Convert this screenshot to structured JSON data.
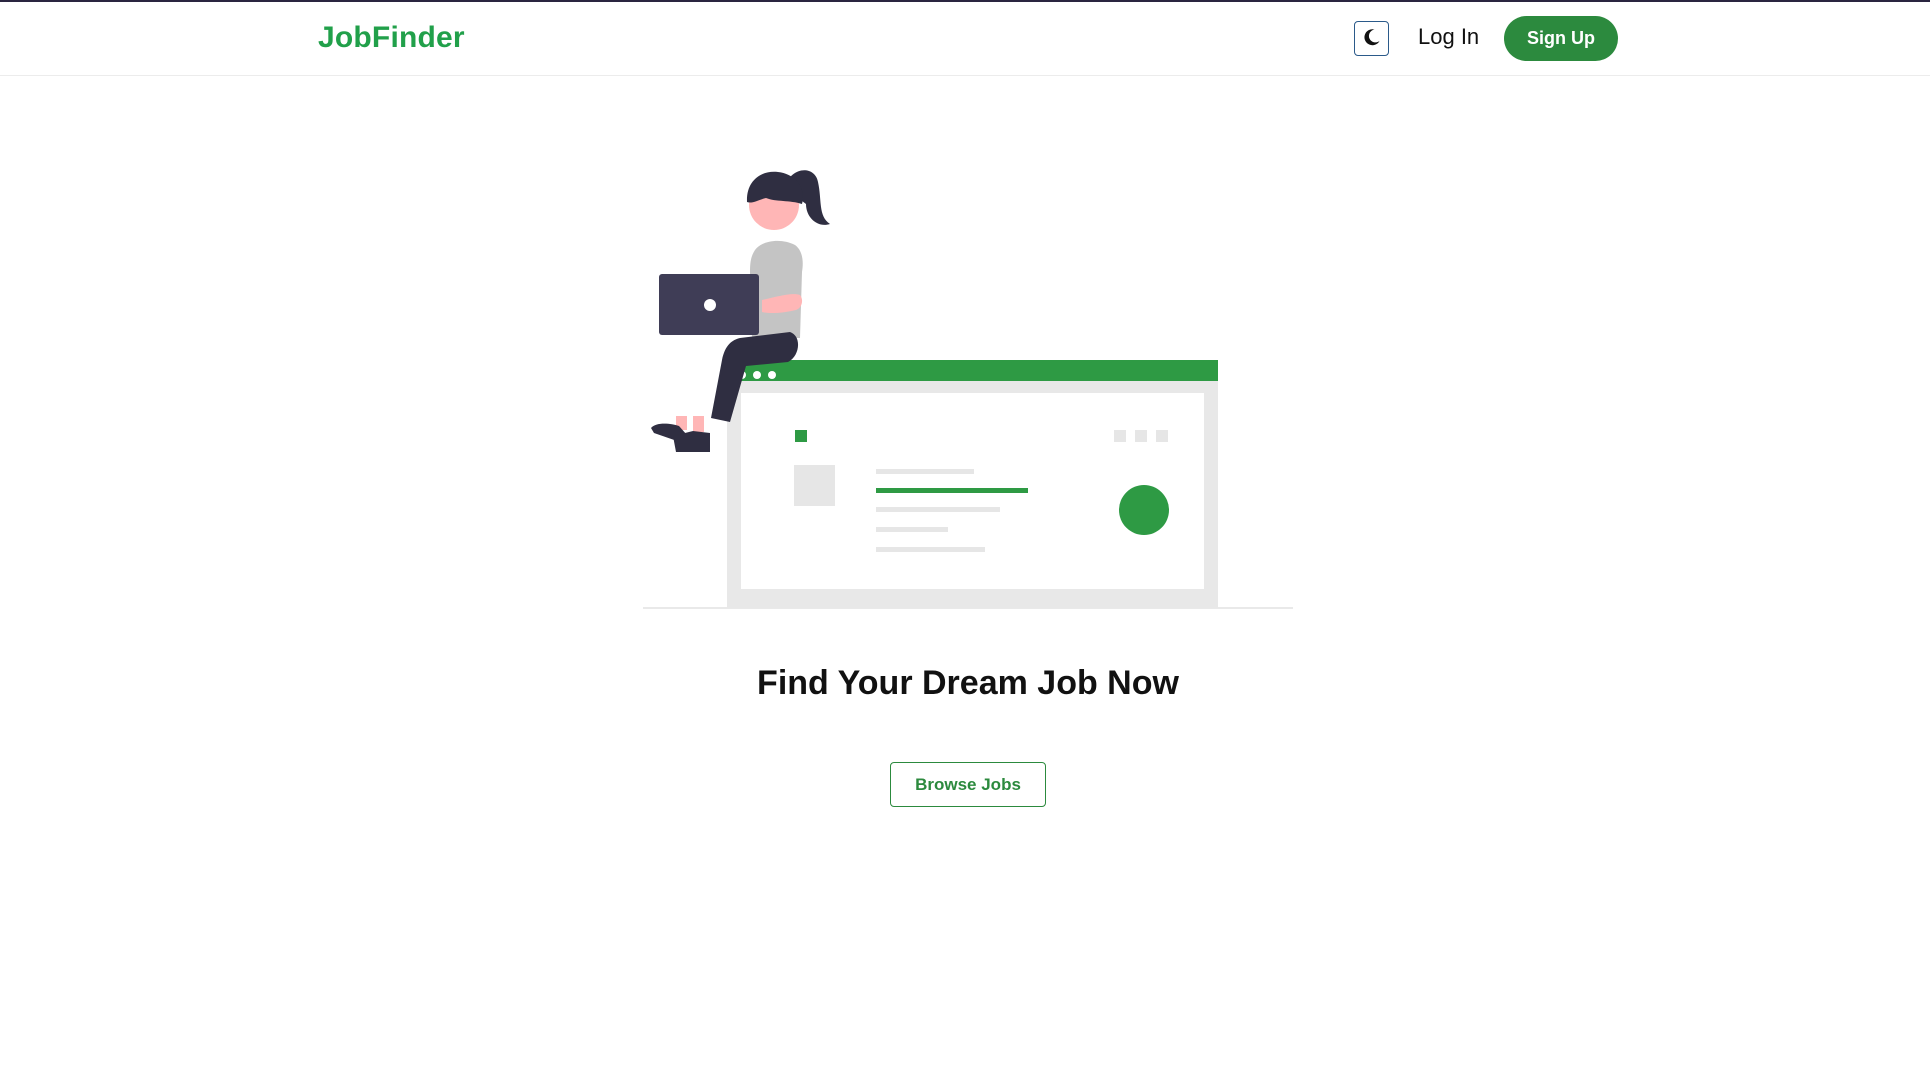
{
  "app": {
    "logo_text": "JobFinder",
    "brand_color": "#21a04a",
    "accent_color": "#2c8a3e"
  },
  "header": {
    "theme_toggle_icon": "moon-icon",
    "login_label": "Log In",
    "signup_label": "Sign Up"
  },
  "hero": {
    "illustration": "woman-with-laptop-on-browser-window",
    "title": "Find Your Dream Job Now",
    "browse_label": "Browse Jobs"
  }
}
